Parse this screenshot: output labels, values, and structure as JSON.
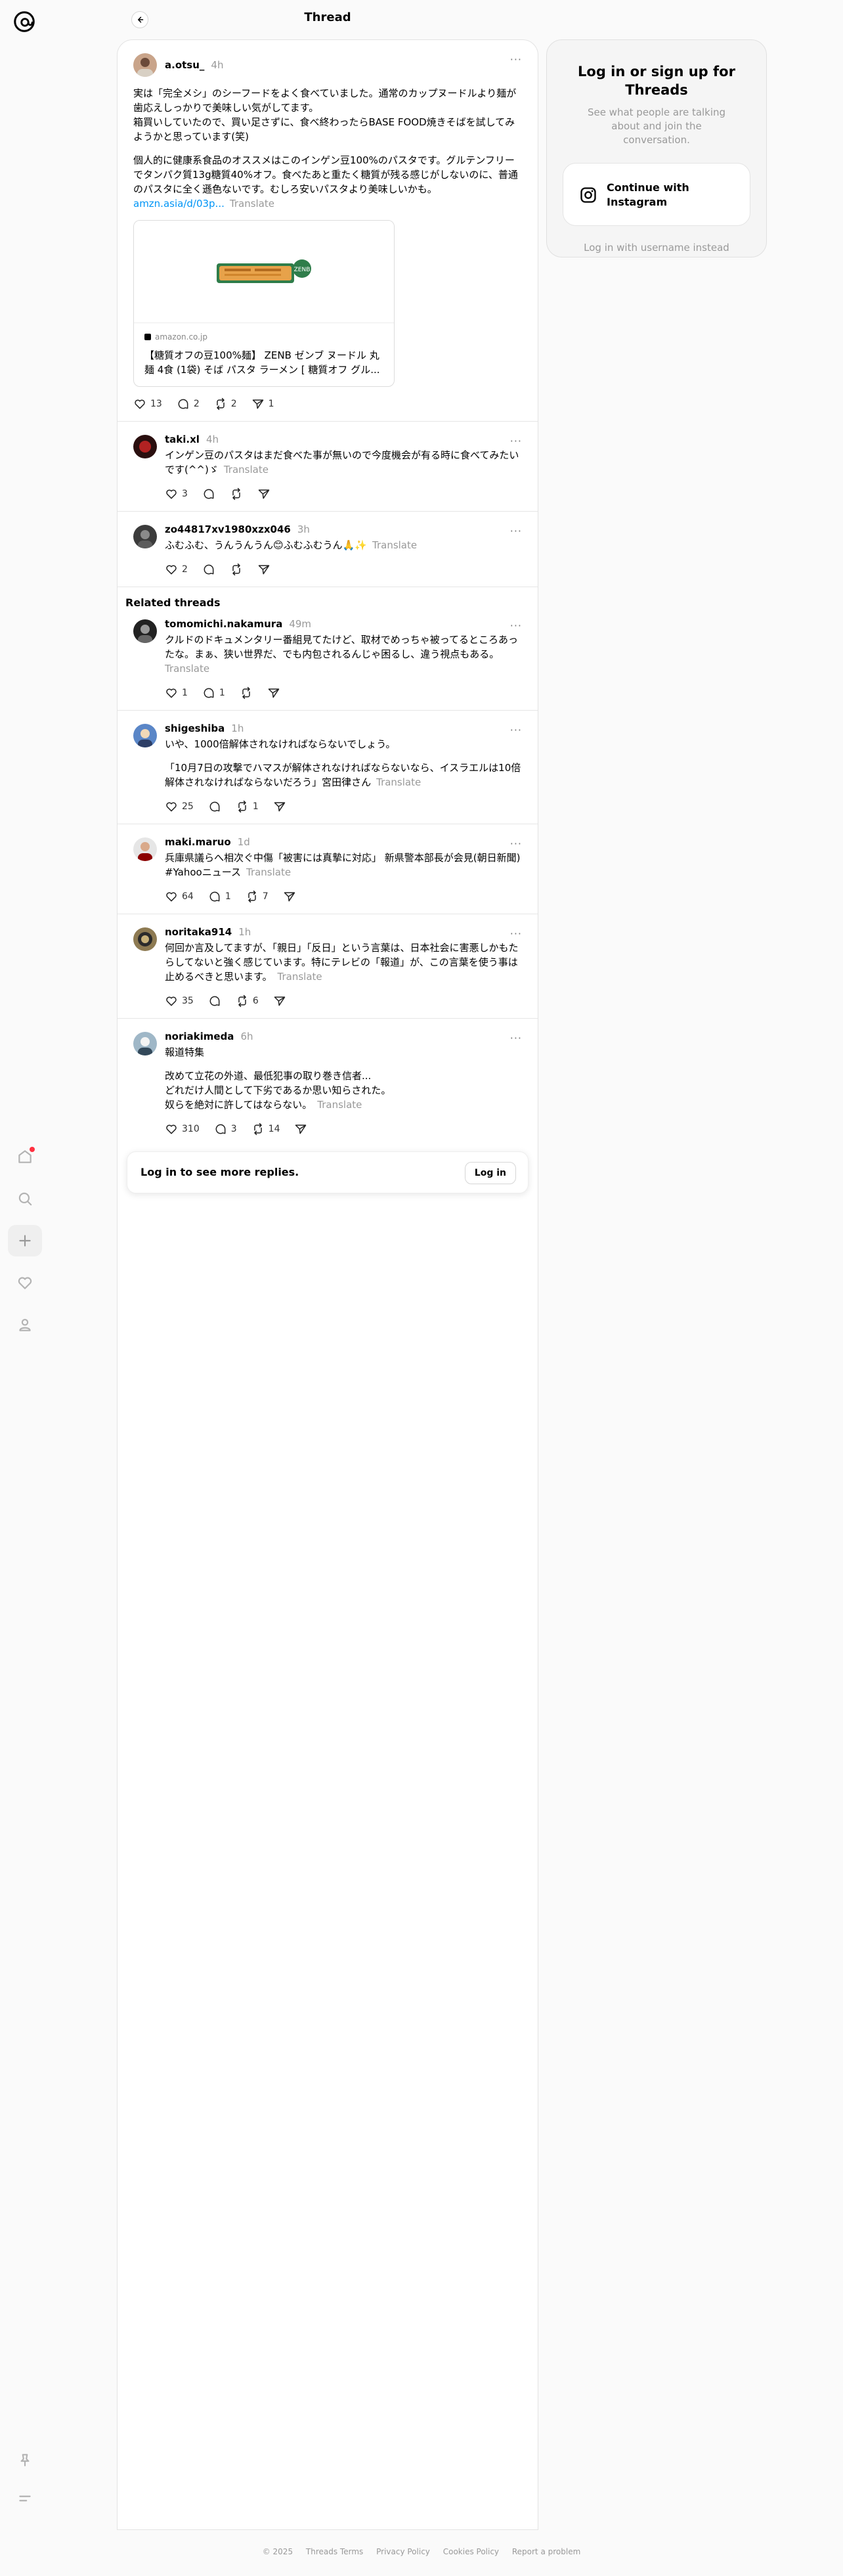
{
  "header": {
    "title": "Thread"
  },
  "sidebar": {
    "items": [
      {
        "name": "home-icon",
        "active": false,
        "notification": true
      },
      {
        "name": "search-icon",
        "active": false
      },
      {
        "name": "plus-icon",
        "active": true
      },
      {
        "name": "heart-icon",
        "active": false
      },
      {
        "name": "profile-icon",
        "active": false
      }
    ],
    "bottom": [
      "pin-icon",
      "menu-icon"
    ]
  },
  "main_post": {
    "username": "a.otsu_",
    "time": "4h",
    "paragraph1": "実は「完全メシ」のシーフードをよく食べていました。通常のカップヌードルより麺が歯応えしっかりで美味しい気がしてます。\n箱買いしていたので、買い足さずに、食べ終わったらBASE FOOD焼きそばを試してみようかと思っています(笑)",
    "paragraph2": "個人的に健康系食品のオススメはこのインゲン豆100%のパスタです。グルテンフリーでタンパク質13g糖質40%オフ。食べたあと重たく糖質が残る感じがしないのに、普通のパスタに全く遜色ないです。むしろ安いパスタより美味しいかも。",
    "link": "amzn.asia/d/03p...",
    "translate": "Translate",
    "card": {
      "domain": "amazon.co.jp",
      "title": "【糖質オフの豆100%麺】 ZENB ゼンブ ヌードル 丸麺 4食 (1袋) そば パスタ ラーメン [ 糖質オフ グル..."
    },
    "likes": "13",
    "replies": "2",
    "reposts": "2",
    "shares": "1"
  },
  "replies": [
    {
      "username": "taki.xl",
      "time": "4h",
      "text": "インゲン豆のパスタはまだ食べた事が無いので今度機会が有る時に食べてみたいです(^^)ゞ",
      "translate": "Translate",
      "likes": "3",
      "replies": "",
      "reposts": ""
    },
    {
      "username": "zo44817xv1980xzx046",
      "time": "3h",
      "text": "ふむふむ、うんうんうん😊ふむふむうん🙏✨",
      "translate": "Translate",
      "likes": "2",
      "replies": "",
      "reposts": ""
    }
  ],
  "related_title": "Related threads",
  "related": [
    {
      "username": "tomomichi.nakamura",
      "time": "49m",
      "text": "クルドのドキュメンタリー番組見てたけど、取材でめっちゃ被ってるところあったな。まぁ、狭い世界だ、でも内包されるんじゃ困るし、違う視点もある。",
      "translate": "Translate",
      "likes": "1",
      "replies": "1",
      "reposts": ""
    },
    {
      "username": "shigeshiba",
      "time": "1h",
      "text": "いや、1000倍解体されなければならないでしょう。",
      "text2": "「10月7日の攻撃でハマスが解体されなければならないなら、イスラエルは10倍解体されなければならないだろう」宮田律さん",
      "translate": "Translate",
      "likes": "25",
      "replies": "",
      "reposts": "1"
    },
    {
      "username": "maki.maruo",
      "time": "1d",
      "text": "兵庫県議らへ相次ぐ中傷「被害には真摯に対応」 新県警本部長が会見(朝日新聞) #Yahooニュース",
      "translate": "Translate",
      "likes": "64",
      "replies": "1",
      "reposts": "7"
    },
    {
      "username": "noritaka914",
      "time": "1h",
      "text": "何回か言及してますが、「親日」「反日」という言葉は、日本社会に害悪しかもたらしてないと強く感じています。特にテレビの「報道」が、この言葉を使う事は止めるべきと思います。",
      "translate": "Translate",
      "likes": "35",
      "replies": "",
      "reposts": "6"
    },
    {
      "username": "noriakimeda",
      "time": "6h",
      "text": "報道特集",
      "text2": "改めて立花の外道、最低犯事の取り巻き信者...\nどれだけ人間として下劣であるか思い知らされた。\n奴らを絶対に許してはならない。",
      "translate": "Translate",
      "likes": "310",
      "replies": "3",
      "reposts": "14"
    }
  ],
  "login_prompt": {
    "text": "Log in to see more replies.",
    "button": "Log in"
  },
  "side_panel": {
    "title": "Log in or sign up for Threads",
    "subtitle": "See what people are talking about and join the conversation.",
    "instagram_button": "Continue with Instagram",
    "alt_login": "Log in with username instead"
  },
  "footer": [
    "© 2025",
    "Threads Terms",
    "Privacy Policy",
    "Cookies Policy",
    "Report a problem"
  ]
}
